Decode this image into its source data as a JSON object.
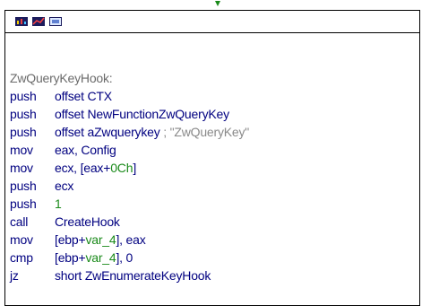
{
  "colors": {
    "label": "#6b6b6b",
    "instruction": "#000080",
    "number": "#1a8a1a",
    "comment": "#8a8a8a",
    "border": "#000000",
    "arrow": "#1a8a1a"
  },
  "toolbar": {
    "icons": [
      "graph-overview-icon",
      "edit-graph-icon",
      "zoom-icon"
    ]
  },
  "code": {
    "label": "ZwQueryKeyHook:",
    "lines": [
      {
        "ins": "push",
        "op1": "offset CTX"
      },
      {
        "ins": "push",
        "op1": "offset NewFunctionZwQueryKey"
      },
      {
        "ins": "push",
        "op1": "offset aZwquerykey",
        "comment": "; \"ZwQueryKey\""
      },
      {
        "ins": "mov",
        "op1": "eax, Config"
      },
      {
        "ins": "mov",
        "op1": "ecx, [eax+",
        "num": "0Ch",
        "op2": "]"
      },
      {
        "ins": "push",
        "op1": "ecx"
      },
      {
        "ins": "push",
        "num": "1"
      },
      {
        "ins": "call",
        "op1": "CreateHook"
      },
      {
        "ins": "mov",
        "op1": "[ebp+",
        "num": "var_4",
        "op2": "], eax"
      },
      {
        "ins": "cmp",
        "op1": "[ebp+",
        "num": "var_4",
        "op2": "], 0"
      },
      {
        "ins": "jz",
        "op1": "short ZwEnumerateKeyHook"
      }
    ]
  }
}
